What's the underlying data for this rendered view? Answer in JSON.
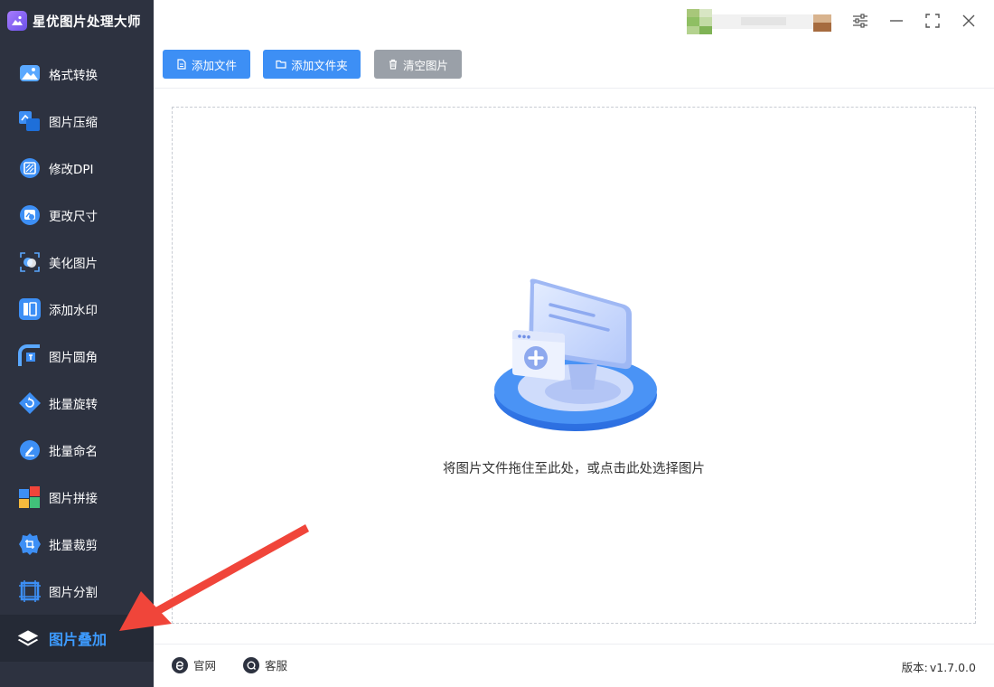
{
  "app": {
    "title": "星优图片处理大师",
    "logo_icon": "picture-icon"
  },
  "sidebar": {
    "items": [
      {
        "label": "格式转换",
        "icon": "format-convert-icon"
      },
      {
        "label": "图片压缩",
        "icon": "compress-icon"
      },
      {
        "label": "修改DPI",
        "icon": "dpi-icon"
      },
      {
        "label": "更改尺寸",
        "icon": "resize-icon"
      },
      {
        "label": "美化图片",
        "icon": "beautify-icon"
      },
      {
        "label": "添加水印",
        "icon": "watermark-icon"
      },
      {
        "label": "图片圆角",
        "icon": "rounded-corner-icon"
      },
      {
        "label": "批量旋转",
        "icon": "rotate-icon"
      },
      {
        "label": "批量命名",
        "icon": "rename-icon"
      },
      {
        "label": "图片拼接",
        "icon": "stitch-icon"
      },
      {
        "label": "批量裁剪",
        "icon": "crop-icon"
      },
      {
        "label": "图片分割",
        "icon": "split-icon"
      }
    ],
    "active": {
      "label": "图片叠加",
      "icon": "layers-icon"
    }
  },
  "toolbar": {
    "add_file": "添加文件",
    "add_folder": "添加文件夹",
    "clear_images": "清空图片"
  },
  "dropzone": {
    "hint": "将图片文件拖住至此处，或点击此处选择图片"
  },
  "footer": {
    "website": "官网",
    "support": "客服",
    "version_label": "版本:",
    "version": "v1.7.0.0"
  },
  "colors": {
    "sidebar_bg": "#2d3240",
    "accent": "#3d8ff5",
    "active_label": "#3d9bff",
    "annotation": "#f0453a"
  }
}
